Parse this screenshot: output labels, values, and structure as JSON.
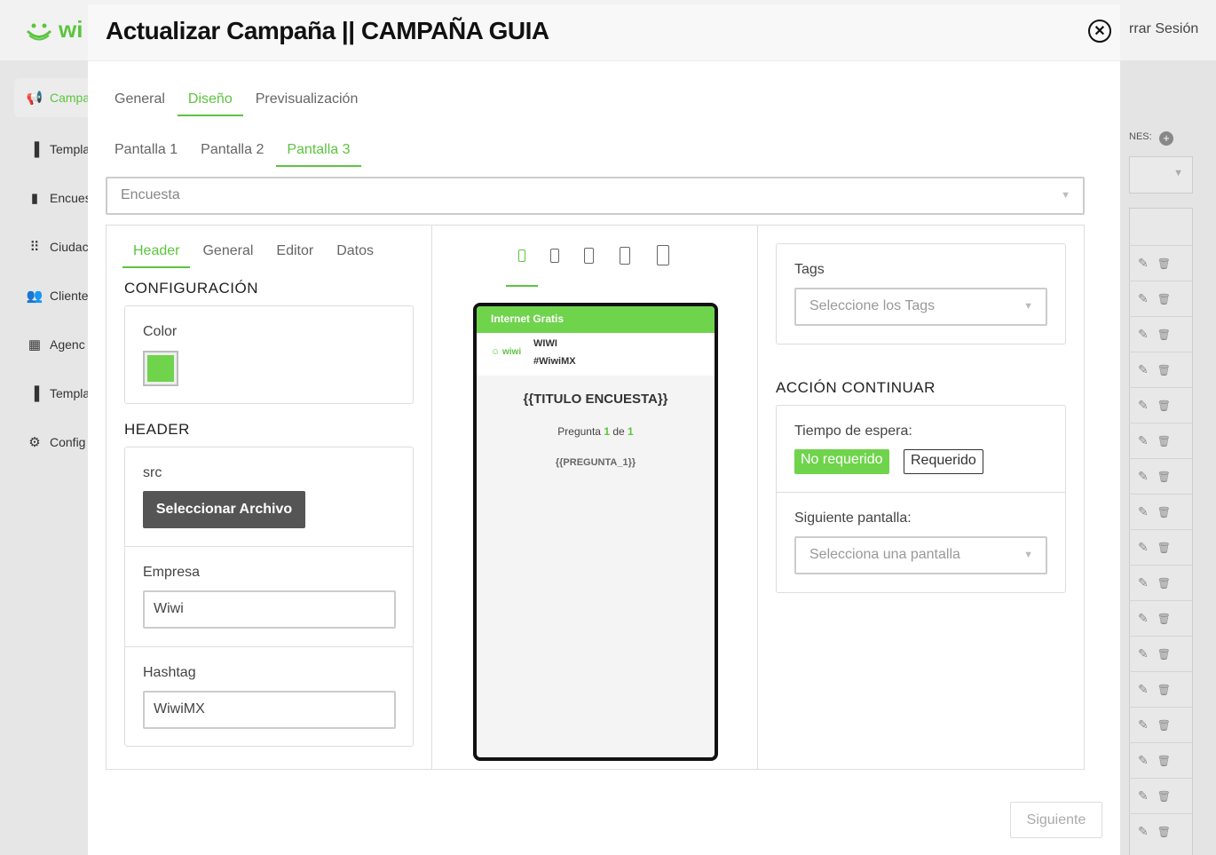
{
  "background": {
    "logo_text": "wi",
    "logout_label": "rrar Sesión",
    "nav": [
      {
        "label": "Campa",
        "icon": "megaphone-icon",
        "active": true
      },
      {
        "label": "Templa",
        "icon": "template-icon"
      },
      {
        "label": "Encues",
        "icon": "clipboard-icon"
      },
      {
        "label": "Ciudac",
        "icon": "dots-grid-icon"
      },
      {
        "label": "Cliente",
        "icon": "users-icon"
      },
      {
        "label": "Agenc",
        "icon": "building-icon"
      },
      {
        "label": "Templa",
        "icon": "template-icon"
      },
      {
        "label": "Config",
        "icon": "gear-icon"
      }
    ],
    "right_label": "NES:"
  },
  "modal": {
    "title": "Actualizar Campaña || CAMPAÑA GUIA",
    "tabs": [
      "General",
      "Diseño",
      "Previsualización"
    ],
    "active_tab": 1,
    "screen_tabs": [
      "Pantalla 1",
      "Pantalla 2",
      "Pantalla 3"
    ],
    "active_screen_tab": 2,
    "screen_type": "Encuesta",
    "left_panel": {
      "tabs": [
        "Header",
        "General",
        "Editor",
        "Datos"
      ],
      "active_tab": 0,
      "config_title": "CONFIGURACIÓN",
      "color_label": "Color",
      "color_value": "#6fd44c",
      "header_title": "HEADER",
      "src_label": "src",
      "select_file_button": "Seleccionar Archivo",
      "company_label": "Empresa",
      "company_value": "Wiwi",
      "hashtag_label": "Hashtag",
      "hashtag_value": "WiwiMX"
    },
    "preview": {
      "bar_text": "Internet Gratis",
      "logo_text": "wiwi",
      "company": "WIWI",
      "hashtag": "#WiwiMX",
      "survey_title": "{{TITULO ENCUESTA}}",
      "question_prefix": "Pregunta",
      "question_current": "1",
      "question_of": "de",
      "question_total": "1",
      "question_placeholder": "{{PREGUNTA_1}}"
    },
    "right_panel": {
      "tags_label": "Tags",
      "tags_placeholder": "Seleccione los Tags",
      "action_title": "ACCIÓN CONTINUAR",
      "wait_label": "Tiempo de espera:",
      "not_required": "No requerido",
      "required": "Requerido",
      "next_screen_label": "Siguiente pantalla:",
      "next_screen_placeholder": "Selecciona una pantalla"
    },
    "next_button": "Siguiente"
  },
  "colors": {
    "accent": "#5cc43f",
    "header_green": "#6fd44c"
  }
}
